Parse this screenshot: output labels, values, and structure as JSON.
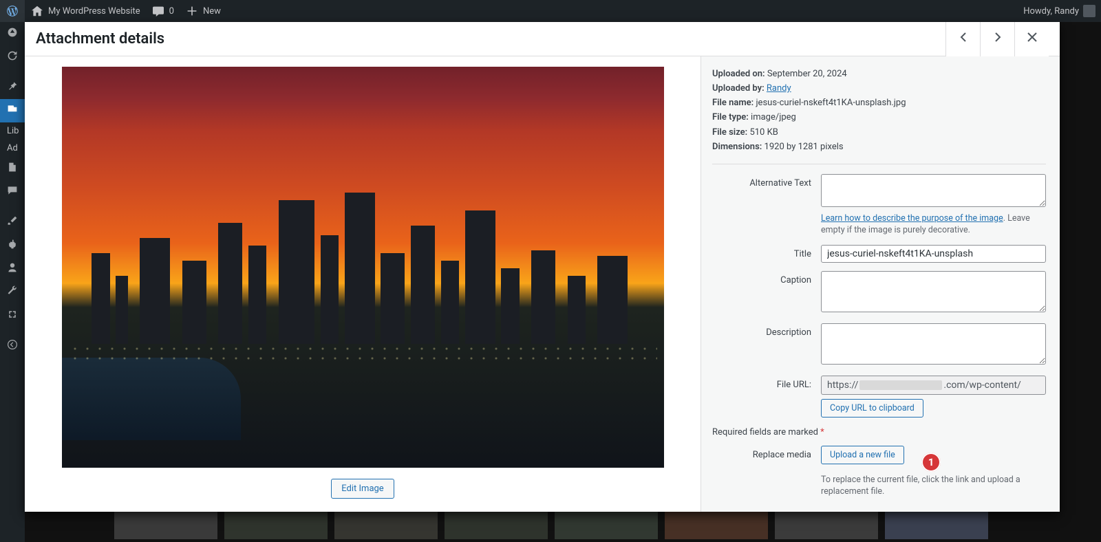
{
  "adminbar": {
    "site_name": "My WordPress Website",
    "comments_count": "0",
    "new_label": "New",
    "howdy": "Howdy, Randy"
  },
  "adminmenu": {
    "sub_library": "Lib",
    "sub_add": "Ad"
  },
  "modal": {
    "title": "Attachment details",
    "edit_image": "Edit Image"
  },
  "details": {
    "uploaded_on_label": "Uploaded on:",
    "uploaded_on": "September 20, 2024",
    "uploaded_by_label": "Uploaded by:",
    "uploaded_by": "Randy",
    "file_name_label": "File name:",
    "file_name": "jesus-curiel-nskeft4t1KA-unsplash.jpg",
    "file_type_label": "File type:",
    "file_type": "image/jpeg",
    "file_size_label": "File size:",
    "file_size": "510 KB",
    "dimensions_label": "Dimensions:",
    "dimensions": "1920 by 1281 pixels"
  },
  "fields": {
    "alt_label": "Alternative Text",
    "alt_value": "",
    "alt_help_link": "Learn how to describe the purpose of the image",
    "alt_help_rest": ". Leave empty if the image is purely decorative.",
    "title_label": "Title",
    "title_value": "jesus-curiel-nskeft4t1KA-unsplash",
    "caption_label": "Caption",
    "caption_value": "",
    "description_label": "Description",
    "description_value": "",
    "fileurl_label": "File URL:",
    "fileurl_prefix": "https://",
    "fileurl_suffix": ".com/wp-content/",
    "copy_url": "Copy URL to clipboard",
    "required_note": "Required fields are marked ",
    "replace_label": "Replace media",
    "replace_button": "Upload a new file",
    "replace_help": "To replace the current file, click the link and upload a replacement file."
  },
  "annotation": {
    "num": "1"
  }
}
